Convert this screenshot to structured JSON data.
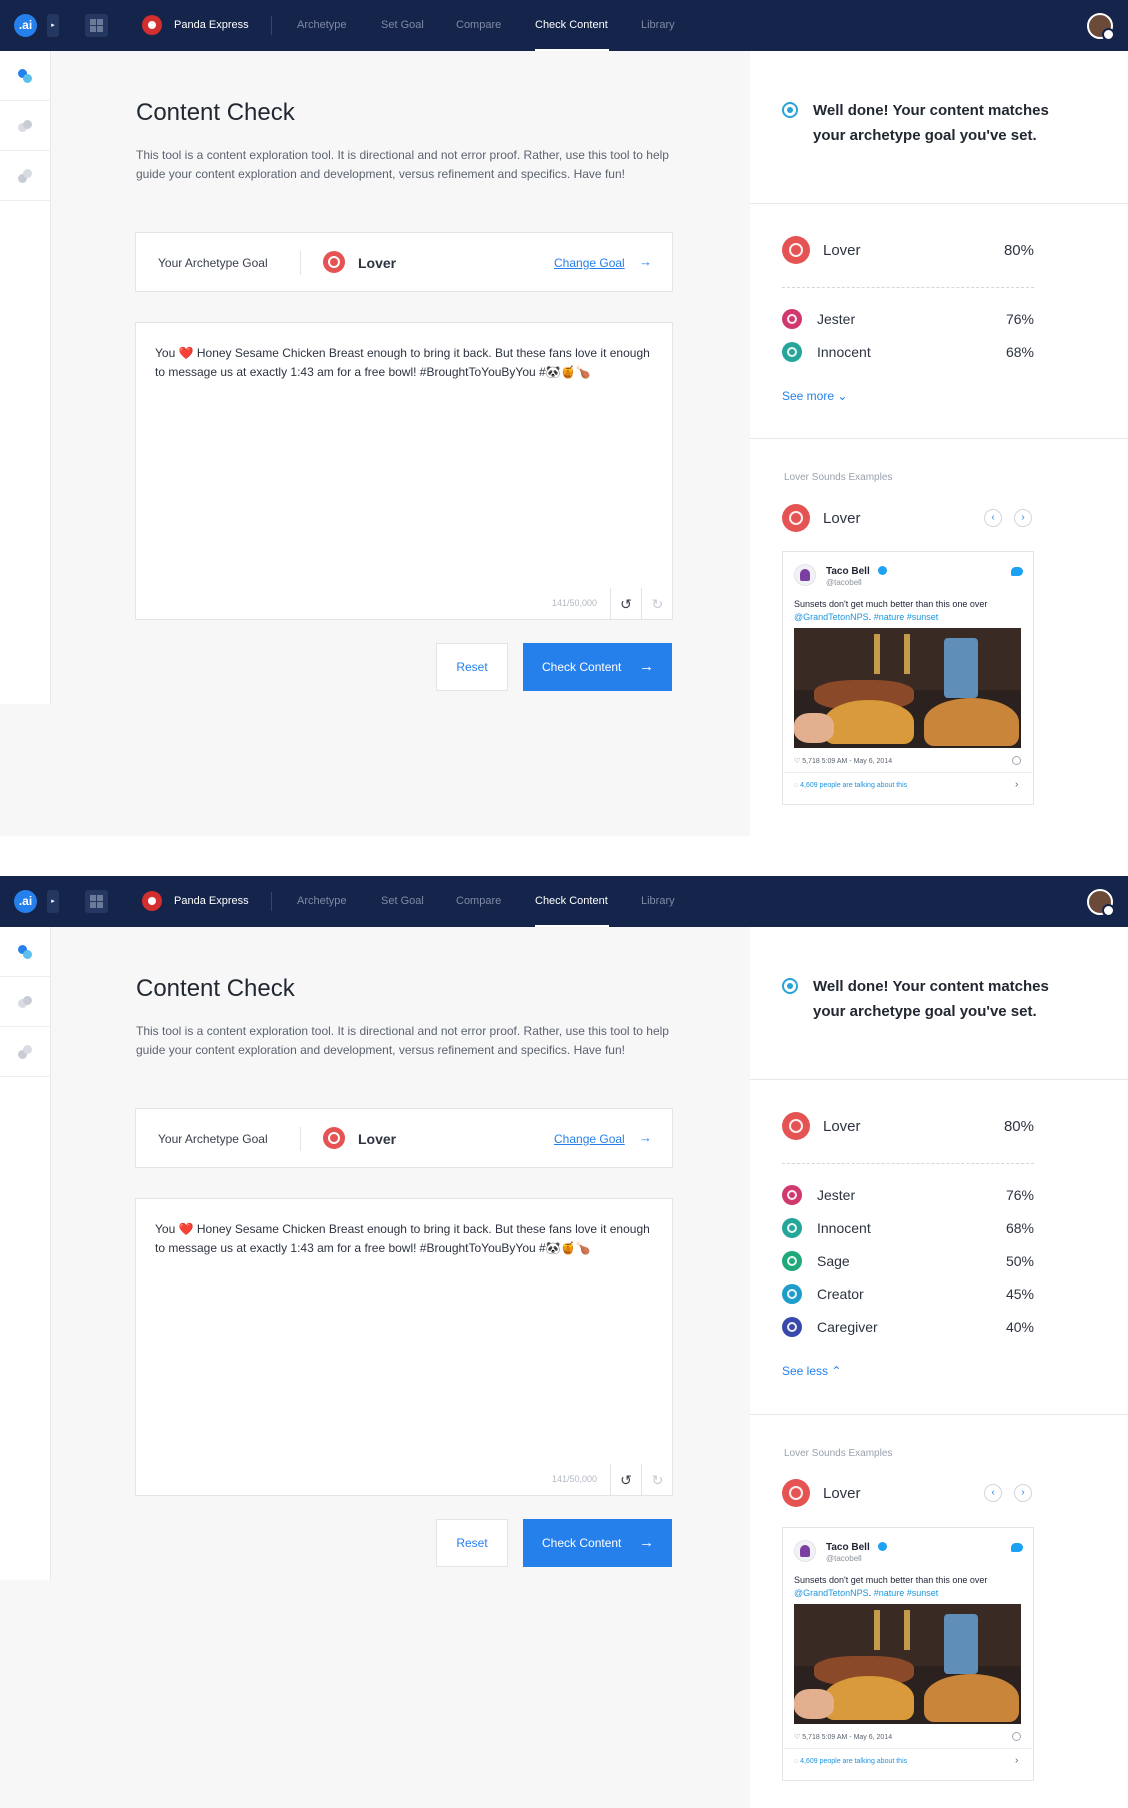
{
  "header": {
    "logo": ".ai",
    "brand": "Panda Express",
    "nav": [
      "Archetype",
      "Set Goal",
      "Compare",
      "Check Content",
      "Library"
    ],
    "active_nav": "Check Content"
  },
  "main": {
    "title": "Content Check",
    "description": "This tool is a content exploration tool.  It is directional and not error proof. Rather, use this tool to help guide your content exploration and development, versus refinement and specifics. Have fun!",
    "goal_label": "Your Archetype Goal",
    "goal_name": "Lover",
    "change_goal": "Change Goal",
    "content": "You ❤️ Honey Sesame Chicken Breast enough to bring it back. But these fans love it enough to message us at exactly 1:43 am for a free bowl! #BroughtToYouByYou #🐼🍯🍗",
    "counter": "141/50,000",
    "reset": "Reset",
    "check": "Check Content"
  },
  "panel": {
    "well_done": "Well done! Your content matches your archetype goal you've set.",
    "top": {
      "name": "Lover",
      "score": "80%"
    },
    "scores_collapsed": [
      {
        "name": "Jester",
        "score": "76%"
      },
      {
        "name": "Innocent",
        "score": "68%"
      }
    ],
    "scores_expanded": [
      {
        "name": "Jester",
        "score": "76%"
      },
      {
        "name": "Innocent",
        "score": "68%"
      },
      {
        "name": "Sage",
        "score": "50%"
      },
      {
        "name": "Creator",
        "score": "45%"
      },
      {
        "name": "Caregiver",
        "score": "40%"
      }
    ],
    "see_more": "See more",
    "see_less": "See less",
    "examples_label": "Lover Sounds Examples",
    "examples_name": "Lover"
  },
  "tweet": {
    "name": "Taco Bell",
    "handle": "@tacobell",
    "text_plain": "Sunsets don't get much better than this one over",
    "text_mention": "@GrandTetonNPS",
    "text_tags": "#nature #sunset",
    "meta": "♡ 5,718   5:09 AM - May 6, 2014",
    "talking": "4,609 people are talking about this"
  },
  "colors": {
    "navy": "#14244a",
    "accent": "#2680eb",
    "lover": "#e55353",
    "jester": "#d0386e",
    "innocent": "#26a69a",
    "sage": "#1fa97a",
    "creator": "#1e9dc9",
    "caregiver": "#3949ab"
  },
  "icons": [
    "logo-icon",
    "grid-icon",
    "brand-icon",
    "avatar",
    "target-icon",
    "undo-icon",
    "redo-icon",
    "arrow-right-icon",
    "chevron-left-icon",
    "chevron-right-icon",
    "twitter-bird-icon",
    "verified-icon",
    "heart-icon",
    "info-icon"
  ]
}
